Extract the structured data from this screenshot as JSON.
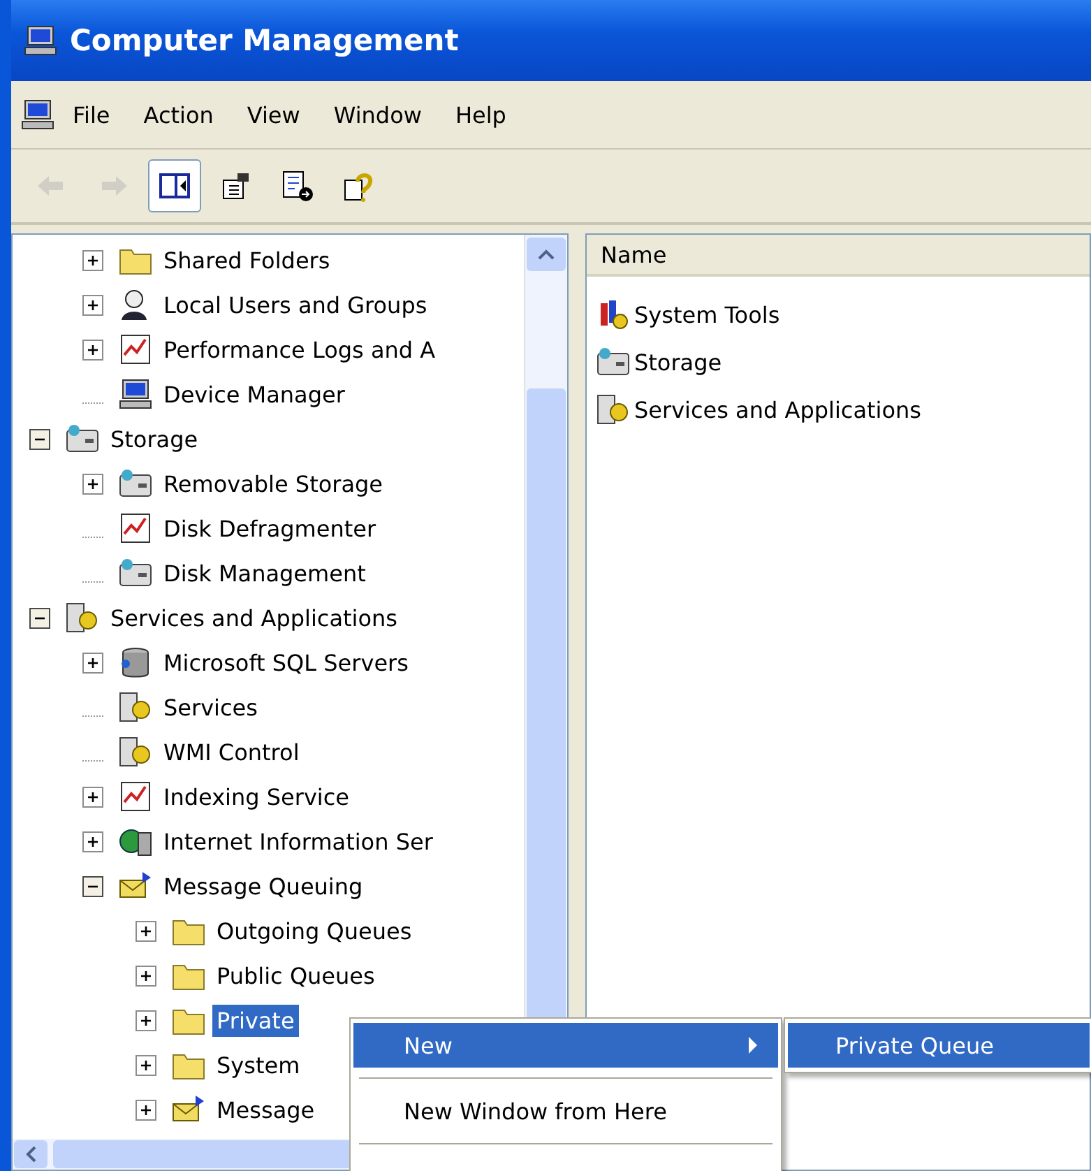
{
  "window": {
    "title": "Computer Management"
  },
  "menu_bar": [
    "File",
    "Action",
    "View",
    "Window",
    "Help"
  ],
  "toolbar": [
    {
      "disabled": true,
      "pressed": false
    },
    {
      "disabled": true,
      "pressed": false
    },
    {
      "disabled": false,
      "pressed": true
    },
    {
      "disabled": false,
      "pressed": false
    },
    {
      "disabled": false,
      "pressed": false
    },
    {
      "disabled": false,
      "pressed": false
    }
  ],
  "tree": {
    "continued_children": [
      {
        "label": "Shared Folders",
        "kind": "branch",
        "expanded": false,
        "selected": false
      },
      {
        "label": "Local Users and Groups",
        "kind": "branch",
        "expanded": false,
        "selected": false
      },
      {
        "label": "Performance Logs and A",
        "kind": "branch",
        "expanded": false,
        "selected": false
      },
      {
        "label": "Device Manager",
        "kind": "leaf",
        "selected": false
      }
    ],
    "items": [
      {
        "label": "Storage",
        "kind": "branch",
        "expanded": true,
        "selected": false,
        "children": [
          {
            "label": "Removable Storage",
            "kind": "branch",
            "expanded": false,
            "selected": false
          },
          {
            "label": "Disk Defragmenter",
            "kind": "leaf",
            "selected": false
          },
          {
            "label": "Disk Management",
            "kind": "leaf",
            "selected": false
          }
        ]
      },
      {
        "label": "Services and Applications",
        "kind": "branch",
        "expanded": true,
        "selected": false,
        "children": [
          {
            "label": "Microsoft SQL Servers",
            "kind": "branch",
            "expanded": false,
            "selected": false
          },
          {
            "label": "Services",
            "kind": "leaf",
            "selected": false
          },
          {
            "label": "WMI Control",
            "kind": "leaf",
            "selected": false
          },
          {
            "label": "Indexing Service",
            "kind": "branch",
            "expanded": false,
            "selected": false
          },
          {
            "label": "Internet Information Ser",
            "kind": "branch",
            "expanded": false,
            "selected": false
          },
          {
            "label": "Message Queuing",
            "kind": "branch",
            "expanded": true,
            "selected": false,
            "children": [
              {
                "label": "Outgoing Queues",
                "kind": "branch",
                "expanded": false,
                "selected": false
              },
              {
                "label": "Public Queues",
                "kind": "branch",
                "expanded": false,
                "selected": false
              },
              {
                "label": "Private",
                "kind": "branch",
                "expanded": false,
                "selected": true
              },
              {
                "label": "System",
                "kind": "branch",
                "expanded": false,
                "selected": false
              },
              {
                "label": "Message",
                "kind": "branch",
                "expanded": false,
                "selected": false
              }
            ]
          }
        ]
      }
    ]
  },
  "list": {
    "columns": [
      "Name"
    ],
    "rows": [
      "System Tools",
      "Storage",
      "Services and Applications"
    ]
  },
  "context_menu": {
    "items": [
      {
        "label": "New",
        "kind": "submenu",
        "selected": true
      },
      {
        "kind": "separator"
      },
      {
        "label": "New Window from Here",
        "kind": "item",
        "selected": false
      },
      {
        "kind": "separator"
      }
    ],
    "submenu": [
      {
        "label": "Private Queue",
        "selected": true
      }
    ]
  }
}
